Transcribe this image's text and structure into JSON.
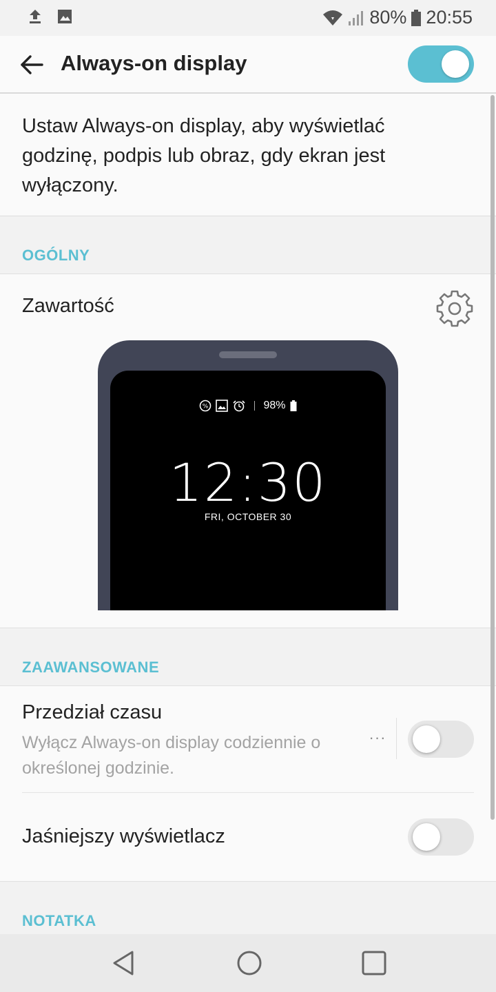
{
  "status_bar": {
    "battery_percent": "80%",
    "time": "20:55",
    "icons": [
      "upload-icon",
      "image-icon",
      "wifi-icon",
      "signal-icon",
      "battery-icon"
    ]
  },
  "app_bar": {
    "title": "Always-on display",
    "master_toggle": "on"
  },
  "description": "Ustaw Always-on display, aby wyświetlać godzinę, podpis lub obraz, gdy ekran jest wyłączony.",
  "sections": {
    "general": "OGÓLNY",
    "advanced": "ZAAWANSOWANE",
    "note": "NOTATKA"
  },
  "content": {
    "title": "Zawartość",
    "preview": {
      "battery": "98%",
      "time": "12:30",
      "date": "FRI, OCTOBER 30"
    }
  },
  "settings": {
    "time_range": {
      "title": "Przedział czasu",
      "subtitle": "Wyłącz Always-on display codziennie o określonej godzinie.",
      "more": "···",
      "toggle": "off"
    },
    "brighter_display": {
      "title": "Jaśniejszy wyświetlacz",
      "toggle": "off"
    }
  },
  "colors": {
    "accent": "#5bbfd2",
    "phone_frame": "#414556"
  }
}
